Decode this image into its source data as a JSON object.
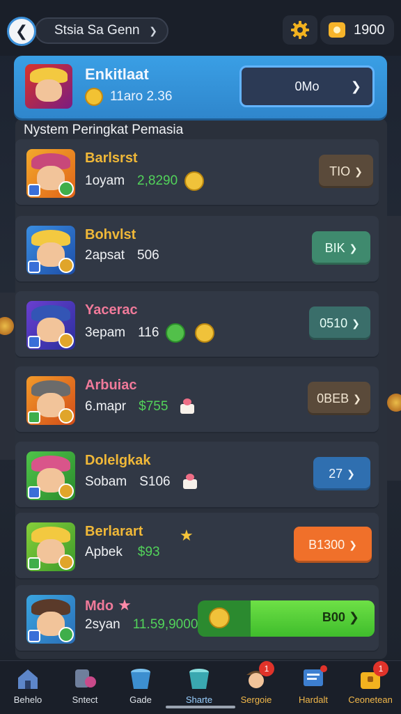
{
  "topbar": {
    "back_icon": "back-arrow-icon",
    "title": "Stsia Sa Genn",
    "coins": "1900"
  },
  "hero": {
    "name": "Enkitlaat",
    "sub": "11aro 2.36",
    "button": "0Mo"
  },
  "section_title": "Nystem Peringkat Pemasia",
  "rows": [
    {
      "name": "Barlsrst",
      "name_color": "#f0b838",
      "rank": "1oyam",
      "value": "2,8290",
      "value_color": "#52d35a",
      "button": "TIO",
      "btn_bg": "#5a4a3a",
      "btn_color": "#f2e6d2"
    },
    {
      "name": "Bohvlst",
      "name_color": "#f0b838",
      "rank": "2apsat",
      "value": "506",
      "value_color": "#f0f2f5",
      "button": "BIK",
      "btn_bg": "#3f8a6e",
      "btn_color": "#e8fff4"
    },
    {
      "name": "Yacerac",
      "name_color": "#f07a9a",
      "rank": "3epam",
      "value": "116",
      "value_color": "#f0f2f5",
      "button": "0510",
      "btn_bg": "#3a6e6a",
      "btn_color": "#e8fff8"
    },
    {
      "name": "Arbuiac",
      "name_color": "#f07a9a",
      "rank": "6.mapr",
      "value": "$755",
      "value_color": "#52d35a",
      "button": "0BEB",
      "btn_bg": "#5a4a3a",
      "btn_color": "#f2e6d2"
    },
    {
      "name": "Dolelgkak",
      "name_color": "#f0b838",
      "rank": "Sobam",
      "value": "S106",
      "value_color": "#f0f2f5",
      "button": "27",
      "btn_bg": "#2f6fb0",
      "btn_color": "#eef6ff"
    },
    {
      "name": "Berlarart",
      "name_color": "#f0b838",
      "rank": "Apbek",
      "value": "$93",
      "value_color": "#52d35a",
      "button": "B1300",
      "btn_bg": "#f0702a",
      "btn_color": "#fff4ea"
    },
    {
      "name": "Mdo",
      "name_color": "#f07a9a",
      "rank": "2syan",
      "value": "11.59,9000",
      "value_color": "#52d35a",
      "button": "B00",
      "progress": 0.3
    }
  ],
  "nav": [
    {
      "label": "Behelo",
      "icon": "home-icon"
    },
    {
      "label": "Sntect",
      "icon": "cards-icon"
    },
    {
      "label": "Gade",
      "icon": "bucket-icon"
    },
    {
      "label": "Sharte",
      "icon": "bucket-icon"
    },
    {
      "label": "Sergoie",
      "icon": "character-icon",
      "badge": "1"
    },
    {
      "label": "Hardalt",
      "icon": "quest-board-icon"
    },
    {
      "label": "Ceonetean",
      "icon": "treasure-box-icon",
      "badge": "1"
    }
  ]
}
